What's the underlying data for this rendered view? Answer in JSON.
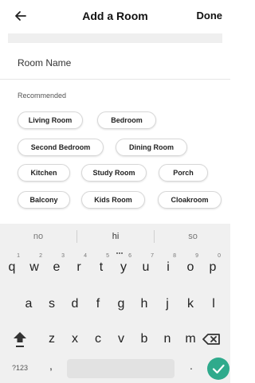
{
  "header": {
    "back_icon": "back-arrow-icon",
    "title": "Add a Room",
    "done_label": "Done"
  },
  "room_name_field": {
    "placeholder": "Room Name"
  },
  "recommended": {
    "label": "Recommended",
    "chips": [
      "Living Room",
      "Bedroom",
      "Second Bedroom",
      "Dining Room",
      "Kitchen",
      "Study Room",
      "Porch",
      "Balcony",
      "Kids Room",
      "Cloakroom"
    ]
  },
  "keyboard": {
    "suggestions": [
      "no",
      "hi",
      "so"
    ],
    "row1": [
      "q",
      "w",
      "e",
      "r",
      "t",
      "y",
      "u",
      "i",
      "o",
      "p"
    ],
    "row1_hints": [
      "1",
      "2",
      "3",
      "4",
      "5",
      "6",
      "7",
      "8",
      "9",
      "0"
    ],
    "row2": [
      "a",
      "s",
      "d",
      "f",
      "g",
      "h",
      "j",
      "k",
      "l"
    ],
    "row3": [
      "z",
      "x",
      "c",
      "v",
      "b",
      "n",
      "m"
    ],
    "symbols_label": "?123",
    "comma": ",",
    "period": ".",
    "accent_color": "#2faa8c",
    "shift_icon": "shift-arrow-icon",
    "backspace_icon": "backspace-icon",
    "enter_icon": "check-icon"
  }
}
